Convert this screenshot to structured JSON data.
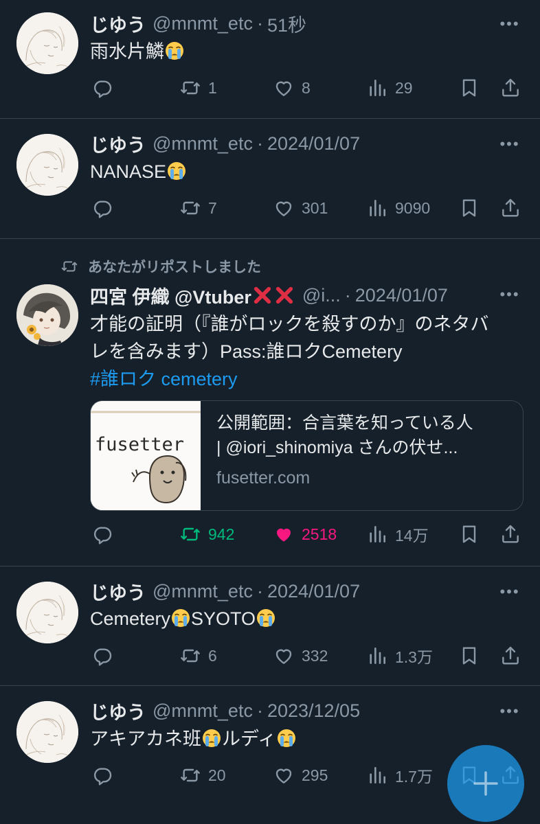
{
  "tweets": [
    {
      "name": "じゆう",
      "handle": "@mnmt_etc",
      "time": "51秒",
      "text": "雨水片鱗",
      "reply": "",
      "retweets": "1",
      "likes": "8",
      "views": "29"
    },
    {
      "name": "じゆう",
      "handle": "@mnmt_etc",
      "time": "2024/01/07",
      "text": "NANASE",
      "reply": "",
      "retweets": "7",
      "likes": "301",
      "views": "9090"
    },
    {
      "retweet_label": "あなたがリポストしました",
      "name": "四宮 伊織 @Vtuber",
      "handle": "@i...",
      "time": "2024/01/07",
      "text_line1": "才能の証明（『誰がロックを殺すのか』のネタバ",
      "text_line2": "レを含みます）Pass:誰ロクCemetery",
      "hashtag": "#誰ロク cemetery",
      "card": {
        "thumb_text": "fusetter",
        "title_line1": "公開範囲：合言葉を知っている人",
        "title_line2": "| @iori_shinomiya さんの伏せ...",
        "domain": "fusetter.com"
      },
      "reply": "",
      "retweets": "942",
      "likes": "2518",
      "views": "14万"
    },
    {
      "name": "じゆう",
      "handle": "@mnmt_etc",
      "time": "2024/01/07",
      "text_a": "Cemetery",
      "text_b": "SYOTO",
      "reply": "",
      "retweets": "6",
      "likes": "332",
      "views": "1.3万"
    },
    {
      "name": "じゆう",
      "handle": "@mnmt_etc",
      "time": "2023/12/05",
      "text_a": "アキアカネ班",
      "text_b": "ルディ",
      "reply": "",
      "retweets": "20",
      "likes": "295",
      "views": "1.7万"
    }
  ],
  "more_label": "•••",
  "separator": "·",
  "colors": {
    "background": "#15202b",
    "text": "#e7e9ea",
    "muted": "#8b98a5",
    "accent": "#1d9bf0",
    "retweet_active": "#00ba7c",
    "like_active": "#f91880",
    "border": "#38444d"
  },
  "icons": [
    "reply-icon",
    "retweet-icon",
    "like-icon",
    "views-icon",
    "bookmark-icon",
    "share-icon",
    "more-icon",
    "compose-icon",
    "crying-emoji",
    "cross-mark-emoji"
  ]
}
